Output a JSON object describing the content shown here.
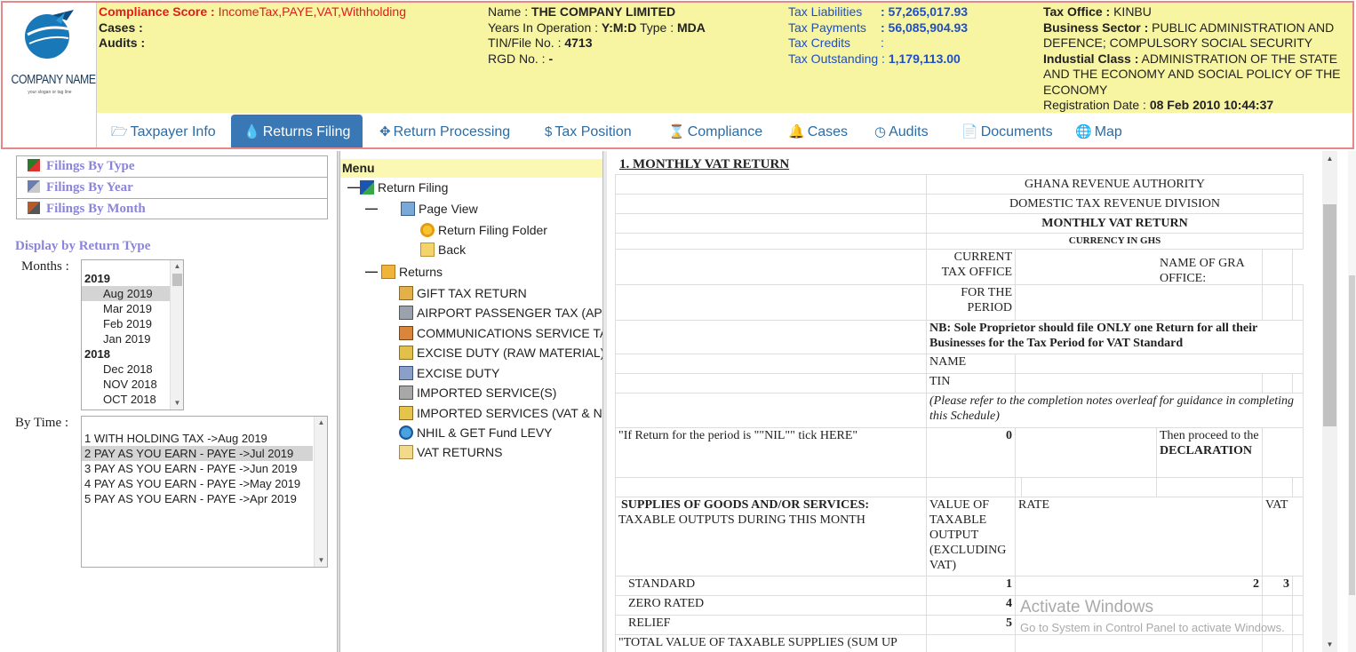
{
  "header": {
    "logo": {
      "name": "COMPANY NAME",
      "slogan": "your slogan or tag line"
    },
    "compliance": {
      "label": "Compliance Score :",
      "value": "IncomeTax,PAYE,VAT,Withholding",
      "cases_label": "Cases :",
      "audits_label": "Audits :"
    },
    "company": {
      "name_label": "Name :",
      "name": "THE COMPANY LIMITED",
      "years_label": "Years In Operation :",
      "years": "Y:M:D",
      "type_label": "Type :",
      "type": "MDA",
      "tin_label": "TIN/File No. :",
      "tin": "4713",
      "rgd_label": "RGD No. :",
      "rgd": "-"
    },
    "tax": {
      "liabilities_label": "Tax Liabilities",
      "liabilities": ": 57,265,017.93",
      "payments_label": "Tax Payments",
      "payments": ": 56,085,904.93",
      "credits_label": "Tax Credits",
      "credits": ":",
      "outstanding_label": "Tax Outstanding :",
      "outstanding": "1,179,113.00"
    },
    "office": {
      "office_label": "Tax Office :",
      "office": "KINBU",
      "sector_label": "Business Sector :",
      "sector": "PUBLIC ADMINISTRATION AND DEFENCE; COMPULSORY SOCIAL SECURITY",
      "class_label": "Industial Class :",
      "class": "ADMINISTRATION OF THE STATE AND THE ECONOMY AND SOCIAL POLICY OF THE ECONOMY",
      "reg_label": "Registration Date :",
      "reg": "08 Feb 2010 10:44:37"
    }
  },
  "nav": {
    "tabs": [
      {
        "label": "Taxpayer Info",
        "icon": "folder-open-icon"
      },
      {
        "label": "Returns Filing",
        "icon": "tint-icon",
        "active": true
      },
      {
        "label": "Return Processing",
        "icon": "move-icon"
      },
      {
        "label": "Tax Position",
        "icon": "dollar-icon"
      },
      {
        "label": "Compliance",
        "icon": "hourglass-icon"
      },
      {
        "label": "Cases",
        "icon": "bell-icon"
      },
      {
        "label": "Audits",
        "icon": "clock-icon"
      },
      {
        "label": "Documents",
        "icon": "file-icon"
      },
      {
        "label": "Map",
        "icon": "globe-icon"
      }
    ]
  },
  "left": {
    "filings": [
      "Filings By Type",
      "Filings By Year",
      "Filings By Month"
    ],
    "display_title": "Display by Return Type",
    "months_label": "Months :",
    "months": [
      {
        "group": "2019"
      },
      {
        "option": "Aug 2019",
        "selected": true
      },
      {
        "option": "Mar 2019"
      },
      {
        "option": "Feb 2019"
      },
      {
        "option": "Jan 2019"
      },
      {
        "group": "2018"
      },
      {
        "option": "Dec 2018"
      },
      {
        "option": "NOV 2018"
      },
      {
        "option": "OCT 2018"
      }
    ],
    "time_label": "By Time :",
    "time_items": [
      "1  WITH HOLDING TAX ->Aug 2019",
      "2  PAY AS YOU EARN - PAYE ->Jul 2019",
      "3  PAY AS YOU EARN - PAYE ->Jun 2019",
      "4  PAY AS YOU EARN - PAYE ->May 2019",
      "5  PAY AS YOU EARN - PAYE ->Apr 2019"
    ],
    "time_selected_index": 1
  },
  "tree": {
    "menu": "Menu",
    "root": "Return Filing",
    "page_view": "Page View",
    "folder": "Return Filing Folder",
    "back": "Back",
    "returns": "Returns",
    "items": [
      "GIFT TAX RETURN",
      "AIRPORT PASSENGER TAX (APT",
      "COMMUNICATIONS SERVICE TA",
      "EXCISE DUTY (RAW MATERIAL)",
      "EXCISE DUTY",
      "IMPORTED SERVICE(S)",
      "IMPORTED SERVICES (VAT & NH",
      "NHIL & GET Fund LEVY",
      "VAT RETURNS"
    ]
  },
  "doc": {
    "title": "1.  MONTHLY VAT RETURN",
    "authority": "GHANA REVENUE AUTHORITY",
    "division": "DOMESTIC TAX REVENUE DIVISION",
    "form": "MONTHLY VAT RETURN",
    "currency": "CURRENCY IN GHS",
    "current_office": "CURRENT TAX OFFICE",
    "gra_office": "NAME OF GRA OFFICE:",
    "for_period": "FOR THE PERIOD",
    "nb": "NB: Sole Proprietor should file ONLY one Return for all their Businesses for the Tax Period for VAT Standard",
    "name": "NAME",
    "tin": "TIN",
    "refer": "(Please refer to the completion notes overleaf for guidance in completing this Schedule)",
    "nil_q": "\"If Return for the period is \"\"NIL\"\" tick HERE\"",
    "nil_val": "0",
    "proceed": "Then proceed to the",
    "declaration": "DECLARATION",
    "supplies_head": "SUPPLIES OF GOODS AND/OR SERVICES:",
    "supplies_sub": "TAXABLE OUTPUTS DURING THIS MONTH",
    "col_value": "VALUE OF TAXABLE OUTPUT (EXCLUDING VAT)",
    "col_rate": "RATE",
    "col_vat": "VAT",
    "rows": [
      {
        "label": "STANDARD",
        "v": "1",
        "r": "2",
        "t": "3"
      },
      {
        "label": "ZERO RATED",
        "v": "4",
        "r": "",
        "t": ""
      },
      {
        "label": "RELIEF",
        "v": "5",
        "r": "",
        "t": ""
      }
    ],
    "cut_row": "\"TOTAL VALUE OF TAXABLE SUPPLIES   (SUM UP"
  },
  "watermark": {
    "line1": "Activate Windows",
    "line2": "Go to System in Control Panel to activate Windows."
  }
}
